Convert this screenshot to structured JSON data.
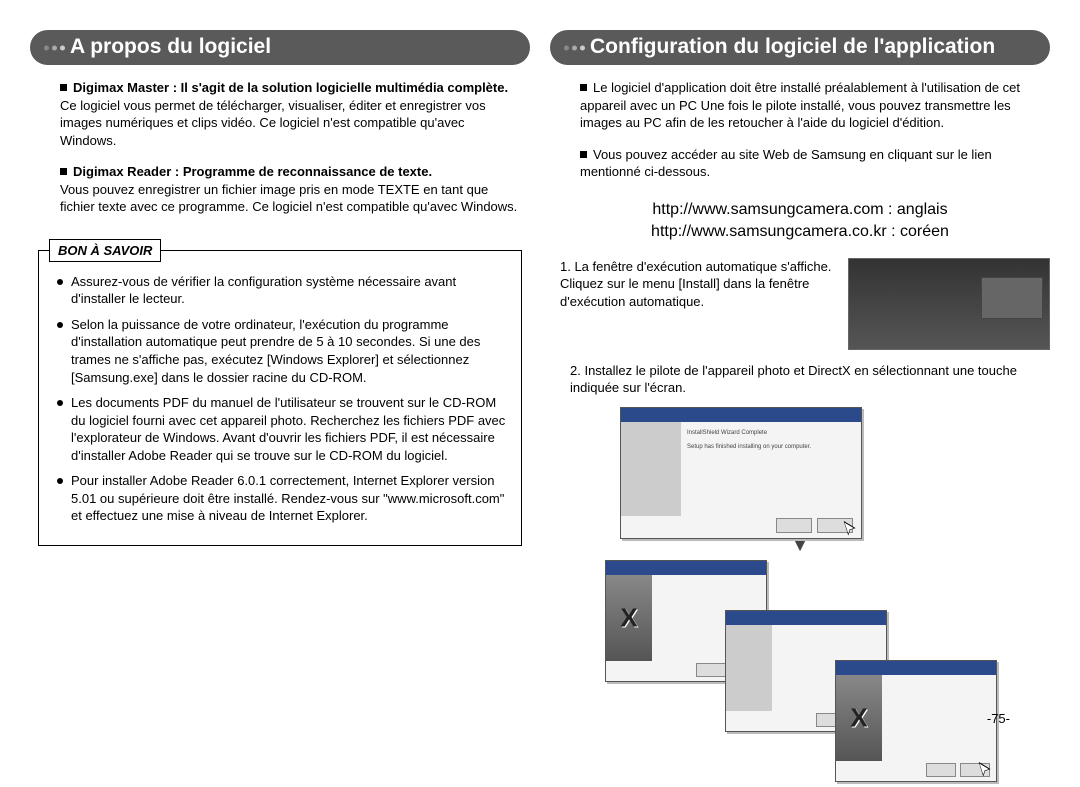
{
  "left": {
    "title": "A propos du logiciel",
    "p1_bold": "Digimax Master : Il s'agit de la solution logicielle multimédia complète.",
    "p1_body": "Ce logiciel vous permet de télécharger, visualiser, éditer et enregistrer vos images numériques et clips vidéo. Ce logiciel n'est compatible qu'avec Windows.",
    "p2_bold": "Digimax Reader : Programme de reconnaissance de texte.",
    "p2_body": "Vous pouvez enregistrer un fichier image pris en mode TEXTE en tant que fichier texte avec ce programme. Ce logiciel n'est compatible qu'avec Windows.",
    "info_title": "BON À SAVOIR",
    "info_items": [
      "Assurez-vous de vérifier la configuration système nécessaire avant d'installer le lecteur.",
      "Selon la puissance de votre ordinateur, l'exécution du programme d'installation automatique peut prendre de 5 à 10 secondes. Si une des trames ne s'affiche pas, exécutez [Windows Explorer] et sélectionnez [Samsung.exe] dans le dossier racine du CD-ROM.",
      "Les documents PDF du manuel de l'utilisateur se trouvent sur le CD-ROM du logiciel fourni avec cet appareil photo. Recherchez les fichiers PDF avec l'explorateur de Windows. Avant d'ouvrir les fichiers PDF, il est nécessaire d'installer Adobe Reader qui se trouve sur le CD-ROM du logiciel.",
      "Pour installer Adobe Reader 6.0.1 correctement, Internet Explorer version 5.01 ou supérieure doit être installé. Rendez-vous sur \"www.microsoft.com\" et effectuez une mise à niveau de Internet Explorer."
    ]
  },
  "right": {
    "title": "Configuration du logiciel de l'application",
    "intro1": "Le logiciel d'application doit être installé préalablement à l'utilisation de cet appareil avec un PC Une fois le pilote installé, vous pouvez transmettre les images au PC afin de les retoucher à l'aide du logiciel d'édition.",
    "intro2": "Vous pouvez accéder au site Web de Samsung en cliquant sur le lien mentionné ci-dessous.",
    "url1": "http://www.samsungcamera.com : anglais",
    "url2": "http://www.samsungcamera.co.kr : coréen",
    "step1": "1. La fenêtre d'exécution automatique s'affiche. Cliquez sur le menu [Install] dans la fenêtre d'exécution automatique.",
    "step2": "2. Installez le pilote de l'appareil photo et DirectX en sélectionnant une touche indiquée sur l'écran.",
    "page_number": "-75-"
  }
}
